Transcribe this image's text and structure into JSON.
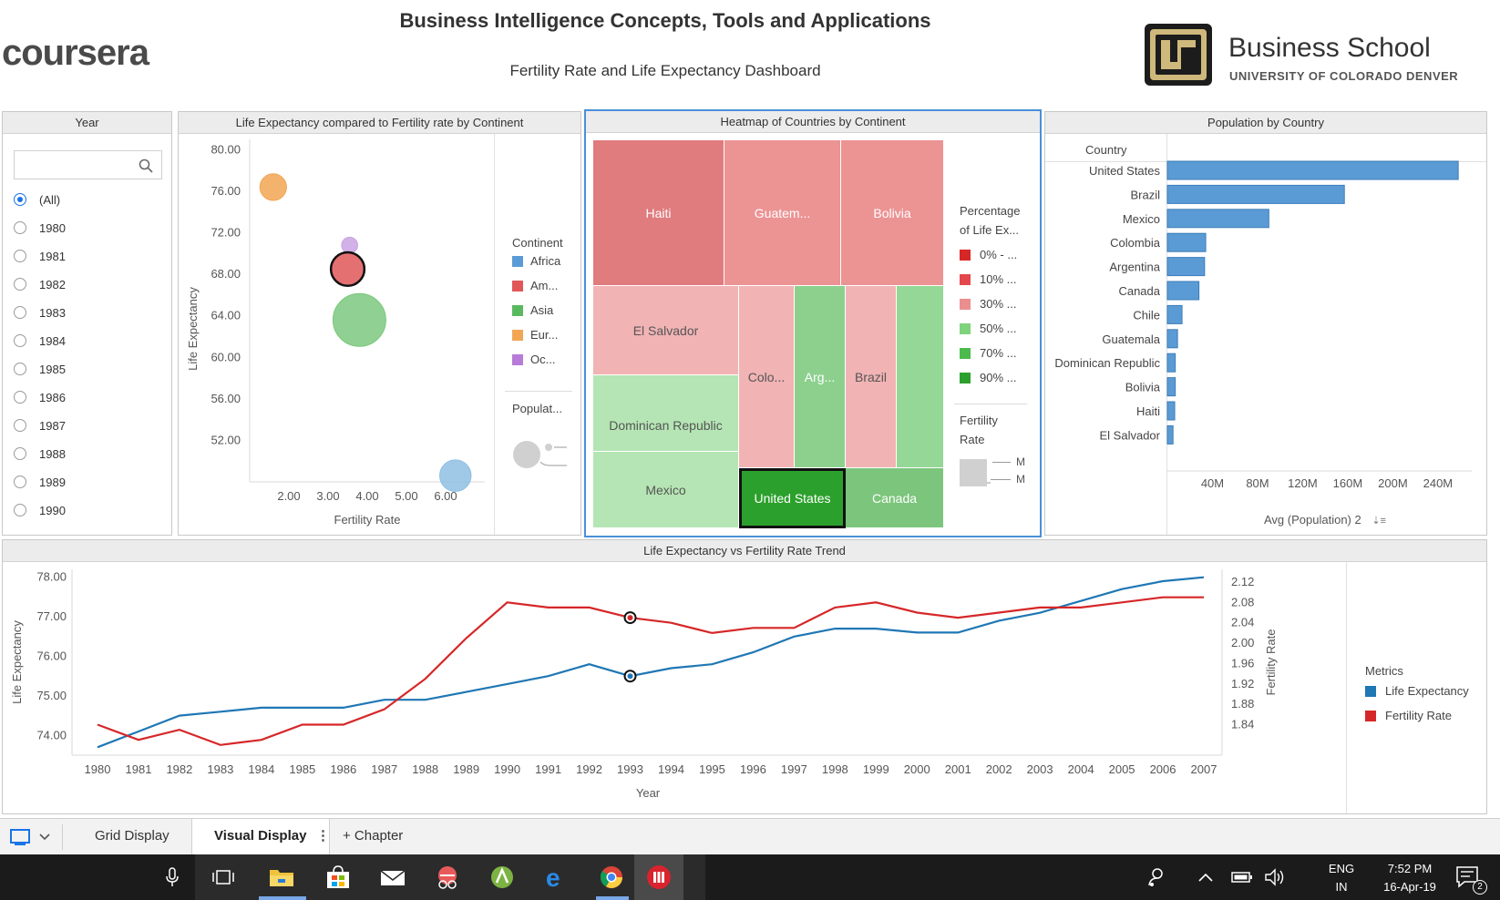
{
  "header": {
    "logo_text": "coursera",
    "title": "Business Intelligence Concepts, Tools and Applications",
    "subtitle": "Fertility Rate and Life Expectancy Dashboard",
    "school_name": "Business School",
    "school_sub": "UNIVERSITY OF COLORADO DENVER"
  },
  "year_filter": {
    "title": "Year",
    "search_placeholder": "",
    "options": [
      "(All)",
      "1980",
      "1981",
      "1982",
      "1983",
      "1984",
      "1985",
      "1986",
      "1987",
      "1988",
      "1989",
      "1990"
    ],
    "selected": "(All)"
  },
  "scatter_panel": {
    "title": "Life Expectancy compared to Fertility rate by Continent",
    "legend_title": "Continent",
    "legend": [
      {
        "label": "Africa",
        "color": "#5b9bd5"
      },
      {
        "label": "Am...",
        "color": "#e15759"
      },
      {
        "label": "Asia",
        "color": "#59b95e"
      },
      {
        "label": "Eur...",
        "color": "#f2a654"
      },
      {
        "label": "Oc...",
        "color": "#b77bd8"
      }
    ],
    "size_legend_title": "Populat..."
  },
  "heatmap_panel": {
    "title": "Heatmap of Countries by Continent",
    "tiles": [
      {
        "label": "Haiti",
        "fill": "#e07b7e",
        "text_color": "#ffffff"
      },
      {
        "label": "Guatem...",
        "fill": "#ec9394",
        "text_color": "#ffffff"
      },
      {
        "label": "Bolivia",
        "fill": "#ec9394",
        "text_color": "#ffffff"
      },
      {
        "label": "El Salvador",
        "fill": "#f1b3b4",
        "text_color": "#555555"
      },
      {
        "label": "Colo...",
        "fill": "#f1b3b4",
        "text_color": "#555555"
      },
      {
        "label": "Arg...",
        "fill": "#8dd08e",
        "text_color": "#ffffff"
      },
      {
        "label": "Brazil",
        "fill": "#f1b3b4",
        "text_color": "#555555"
      },
      {
        "label": "",
        "fill": "#94d796",
        "text_color": "#ffffff"
      },
      {
        "label": "Dominican Republic",
        "fill": "#b5e5b4",
        "text_color": "#555555"
      },
      {
        "label": "Mexico",
        "fill": "#b5e5b4",
        "text_color": "#555555"
      },
      {
        "label": "United States",
        "fill": "#2ca02c",
        "text_color": "#ffffff"
      },
      {
        "label": "Canada",
        "fill": "#7cc57c",
        "text_color": "#ffffff"
      }
    ],
    "legend_title_1": "Percentage",
    "legend_title_2": "of Life Ex...",
    "legend": [
      {
        "label": "0% - ...",
        "color": "#d62728"
      },
      {
        "label": "10% ...",
        "color": "#e5484c"
      },
      {
        "label": "30% ...",
        "color": "#ec8d8f"
      },
      {
        "label": "50% ...",
        "color": "#7fd37c"
      },
      {
        "label": "70% ...",
        "color": "#4cba4c"
      },
      {
        "label": "90% ...",
        "color": "#2ca02c"
      }
    ],
    "size_title_1": "Fertility",
    "size_title_2": "Rate",
    "size_labels": [
      "M",
      "M"
    ]
  },
  "population_panel": {
    "title": "Population by Country",
    "column_header": "Country",
    "axis_title": "Avg (Population) 2",
    "sort_icon": "sort-descending-icon"
  },
  "trend_panel": {
    "title": "Life Expectancy vs Fertility Rate Trend",
    "legend_title": "Metrics",
    "legend": [
      {
        "label": "Life Expectancy",
        "color": "#1f77b4"
      },
      {
        "label": "Fertility Rate",
        "color": "#d62728"
      }
    ]
  },
  "tabs": {
    "items": [
      "Grid Display",
      "Visual Display",
      "+ Chapter"
    ],
    "active": "Visual Display"
  },
  "taskbar": {
    "lang_top": "ENG",
    "lang_bottom": "IN",
    "time": "7:52 PM",
    "date": "16-Apr-19",
    "notification_count": "2"
  },
  "chart_data": [
    {
      "type": "scatter",
      "title": "Life Expectancy compared to Fertility rate by Continent",
      "xlabel": "Fertility Rate",
      "ylabel": "Life Expectancy",
      "xlim": [
        1,
        7
      ],
      "ylim": [
        48,
        81
      ],
      "xticks": [
        2,
        3,
        4,
        5,
        6
      ],
      "xtick_labels": [
        "2.00",
        "3.00",
        "4.00",
        "5.00",
        "6.00"
      ],
      "yticks": [
        52,
        56,
        60,
        64,
        68,
        72,
        76,
        80
      ],
      "ytick_labels": [
        "52.00",
        "56.00",
        "60.00",
        "64.00",
        "68.00",
        "72.00",
        "76.00",
        "80.00"
      ],
      "points": [
        {
          "series": "Eur...",
          "x": 1.6,
          "y": 76.4,
          "size": 0.2,
          "color": "#f2a654"
        },
        {
          "series": "Oc...",
          "x": 3.55,
          "y": 70.8,
          "size": 0.05,
          "color": "#c9a3e3"
        },
        {
          "series": "Am...",
          "x": 3.5,
          "y": 68.5,
          "size": 0.35,
          "color": "#e15759",
          "highlighted": true
        },
        {
          "series": "Asia",
          "x": 3.8,
          "y": 63.6,
          "size": 1.0,
          "color": "#7cc87f"
        },
        {
          "series": "Africa",
          "x": 6.25,
          "y": 48.6,
          "size": 0.3,
          "color": "#8fbfe3"
        }
      ]
    },
    {
      "type": "bar",
      "orientation": "horizontal",
      "title": "Population by Country",
      "xlabel": "Avg (Population) 2",
      "categories": [
        "United States",
        "Brazil",
        "Mexico",
        "Colombia",
        "Argentina",
        "Canada",
        "Chile",
        "Guatemala",
        "Dominican Republic",
        "Bolivia",
        "Haiti",
        "El Salvador"
      ],
      "values": [
        258,
        157,
        90,
        34,
        33,
        28,
        13,
        9,
        7,
        7,
        6.5,
        5
      ],
      "xlim": [
        0,
        270
      ],
      "xticks": [
        40,
        80,
        120,
        160,
        200,
        240
      ],
      "xtick_labels": [
        "40M",
        "80M",
        "120M",
        "160M",
        "200M",
        "240M"
      ]
    },
    {
      "type": "line",
      "title": "Life Expectancy vs Fertility Rate Trend",
      "xlabel": "Year",
      "ylabel": "Life Expectancy",
      "y2label": "Fertility Rate",
      "x": [
        "1980",
        "1981",
        "1982",
        "1983",
        "1984",
        "1985",
        "1986",
        "1987",
        "1988",
        "1989",
        "1990",
        "1991",
        "1992",
        "1993",
        "1994",
        "1995",
        "1996",
        "1997",
        "1998",
        "1999",
        "2000",
        "2001",
        "2002",
        "2003",
        "2004",
        "2005",
        "2006",
        "2007"
      ],
      "ylim": [
        73.5,
        78.2
      ],
      "y2lim": [
        1.78,
        2.145
      ],
      "yticks": [
        74,
        75,
        76,
        77,
        78
      ],
      "ytick_labels": [
        "74.00",
        "75.00",
        "76.00",
        "77.00",
        "78.00"
      ],
      "y2ticks": [
        1.84,
        1.88,
        1.92,
        1.96,
        2.0,
        2.04,
        2.08,
        2.12
      ],
      "y2tick_labels": [
        "1.84",
        "1.88",
        "1.92",
        "1.96",
        "2.00",
        "2.04",
        "2.08",
        "2.12"
      ],
      "series": [
        {
          "name": "Life Expectancy",
          "axis": "left",
          "color": "#1f77b4",
          "values": [
            73.7,
            74.1,
            74.5,
            74.6,
            74.7,
            74.7,
            74.7,
            74.9,
            74.9,
            75.1,
            75.3,
            75.5,
            75.8,
            75.5,
            75.7,
            75.8,
            76.1,
            76.5,
            76.7,
            76.7,
            76.6,
            76.6,
            76.9,
            77.1,
            77.4,
            77.7,
            77.9,
            78.0
          ]
        },
        {
          "name": "Fertility Rate",
          "axis": "right",
          "color": "#d62728",
          "values": [
            1.84,
            1.81,
            1.83,
            1.8,
            1.81,
            1.84,
            1.84,
            1.87,
            1.93,
            2.01,
            2.08,
            2.07,
            2.07,
            2.05,
            2.04,
            2.02,
            2.03,
            2.03,
            2.07,
            2.08,
            2.06,
            2.05,
            2.06,
            2.07,
            2.07,
            2.08,
            2.09,
            2.09
          ]
        }
      ],
      "highlight_index": 13
    }
  ]
}
